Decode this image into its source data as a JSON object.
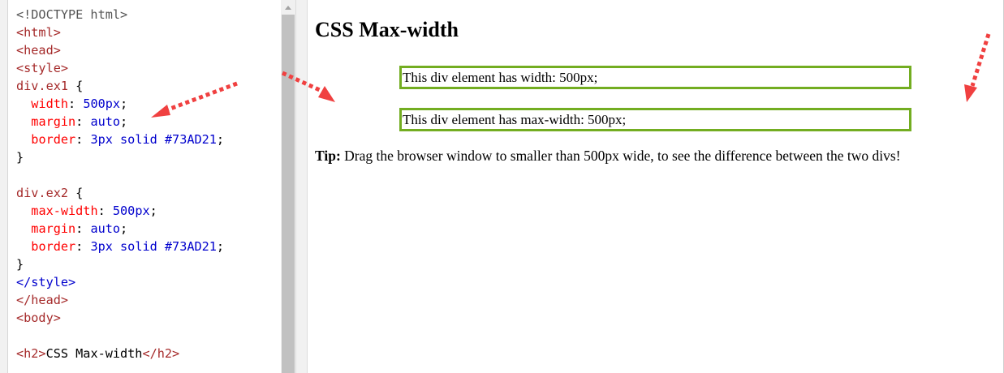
{
  "editor": {
    "lines": [
      [
        {
          "t": "<!DOCTYPE html>",
          "c": "tok-doctype"
        }
      ],
      [
        {
          "t": "<html>",
          "c": "tok-tag"
        }
      ],
      [
        {
          "t": "<head>",
          "c": "tok-tag"
        }
      ],
      [
        {
          "t": "<style>",
          "c": "tok-tag"
        }
      ],
      [
        {
          "t": "div.ex1",
          "c": "tok-selector"
        },
        {
          "t": " {",
          "c": "tok-punct"
        }
      ],
      [
        {
          "t": "  "
        },
        {
          "t": "width",
          "c": "tok-prop"
        },
        {
          "t": ": ",
          "c": "tok-punct"
        },
        {
          "t": "500px",
          "c": "tok-value"
        },
        {
          "t": ";",
          "c": "tok-punct"
        }
      ],
      [
        {
          "t": "  "
        },
        {
          "t": "margin",
          "c": "tok-prop"
        },
        {
          "t": ": ",
          "c": "tok-punct"
        },
        {
          "t": "auto",
          "c": "tok-value"
        },
        {
          "t": ";",
          "c": "tok-punct"
        }
      ],
      [
        {
          "t": "  "
        },
        {
          "t": "border",
          "c": "tok-prop"
        },
        {
          "t": ": ",
          "c": "tok-punct"
        },
        {
          "t": "3px solid #73AD21",
          "c": "tok-value"
        },
        {
          "t": ";",
          "c": "tok-punct"
        }
      ],
      [
        {
          "t": "}",
          "c": "tok-punct"
        }
      ],
      [
        {
          "t": ""
        }
      ],
      [
        {
          "t": "div.ex2",
          "c": "tok-selector"
        },
        {
          "t": " {",
          "c": "tok-punct"
        }
      ],
      [
        {
          "t": "  "
        },
        {
          "t": "max-width",
          "c": "tok-prop"
        },
        {
          "t": ": ",
          "c": "tok-punct"
        },
        {
          "t": "500px",
          "c": "tok-value"
        },
        {
          "t": ";",
          "c": "tok-punct"
        }
      ],
      [
        {
          "t": "  "
        },
        {
          "t": "margin",
          "c": "tok-prop"
        },
        {
          "t": ": ",
          "c": "tok-punct"
        },
        {
          "t": "auto",
          "c": "tok-value"
        },
        {
          "t": ";",
          "c": "tok-punct"
        }
      ],
      [
        {
          "t": "  "
        },
        {
          "t": "border",
          "c": "tok-prop"
        },
        {
          "t": ": ",
          "c": "tok-punct"
        },
        {
          "t": "3px solid #73AD21",
          "c": "tok-value"
        },
        {
          "t": ";",
          "c": "tok-punct"
        }
      ],
      [
        {
          "t": "}",
          "c": "tok-punct"
        }
      ],
      [
        {
          "t": "</style>",
          "c": "tok-tag-blue"
        }
      ],
      [
        {
          "t": "</head>",
          "c": "tok-tag"
        }
      ],
      [
        {
          "t": "<body>",
          "c": "tok-tag"
        }
      ],
      [
        {
          "t": ""
        }
      ],
      [
        {
          "t": "<h2>",
          "c": "tok-tag"
        },
        {
          "t": "CSS Max-width",
          "c": "tok-punct"
        },
        {
          "t": "</h2>",
          "c": "tok-tag"
        }
      ]
    ]
  },
  "preview": {
    "heading": "CSS Max-width",
    "box1_text": "This div element has width: 500px;",
    "box2_text": "This div element has max-width: 500px;",
    "tip_label": "Tip:",
    "tip_text": " Drag the browser window to smaller than 500px wide, to see the difference between the two divs!"
  },
  "colors": {
    "border_green": "#73AD21",
    "arrow_red": "#f04040"
  },
  "icons": {
    "scroll_up": "caret-up-icon",
    "annotation": "dotted-arrow-icon"
  }
}
